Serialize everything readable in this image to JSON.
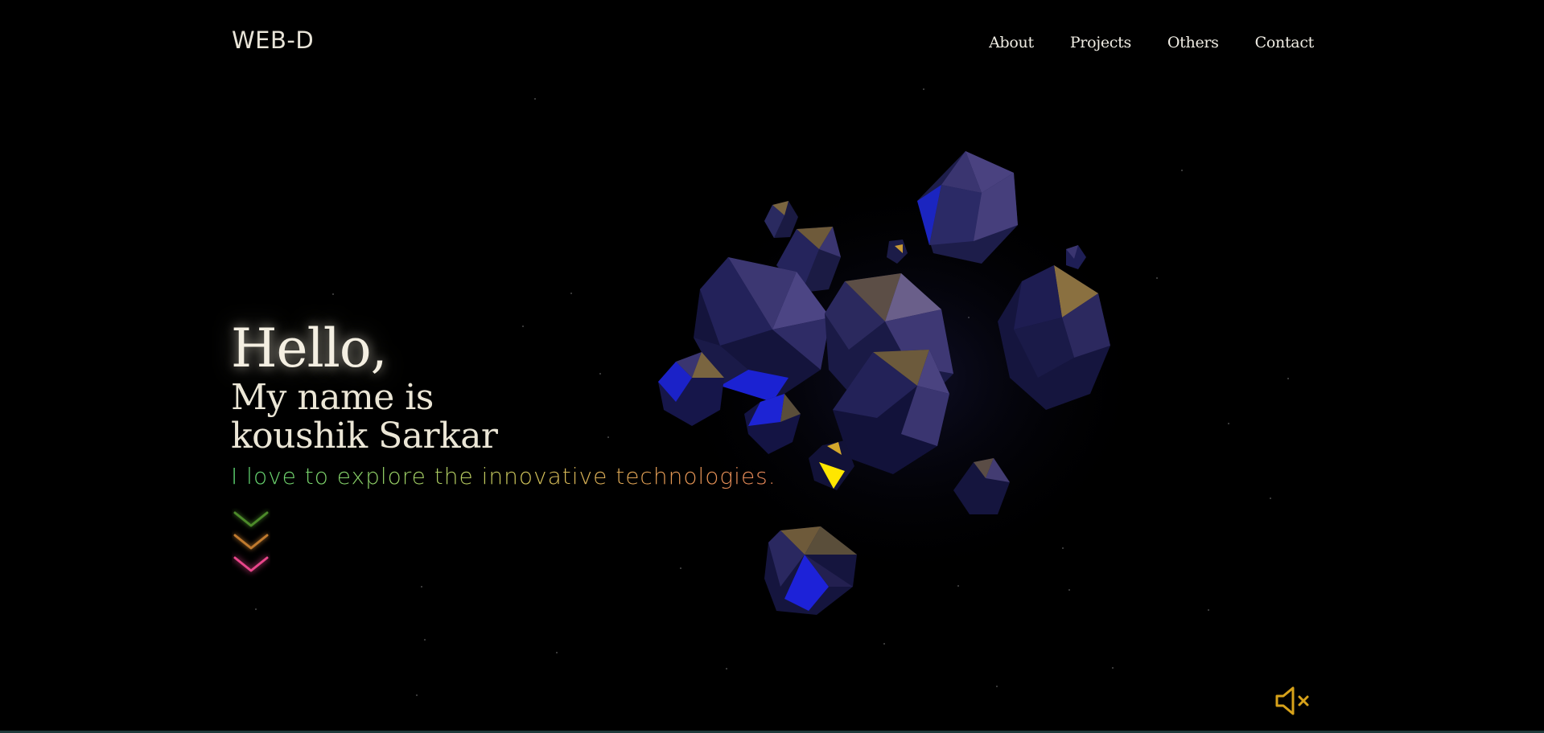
{
  "header": {
    "logo_main": "WEB-",
    "logo_accent": "D",
    "nav": [
      {
        "label": "About"
      },
      {
        "label": "Projects"
      },
      {
        "label": "Others"
      },
      {
        "label": "Contact"
      }
    ]
  },
  "hero": {
    "greeting": "Hello,",
    "name_line1": "My name is",
    "name_line2": "koushik Sarkar",
    "tagline": "I love to explore the innovative technologies."
  },
  "controls": {
    "scroll_down_icon": "triple-chevron-down-icon",
    "sound_icon": "speaker-muted-icon"
  },
  "colors": {
    "background": "#000000",
    "text": "#f0ede4",
    "chevron_1": "#4c8a2a",
    "chevron_2": "#c07a2e",
    "chevron_3": "#e8468a",
    "mute_icon": "#d7a21a",
    "polyhedra_dark": "#1a1a4a",
    "polyhedra_blue": "#1d22d6",
    "polyhedra_gold": "#8a7040",
    "highlight": "#ffe600"
  }
}
